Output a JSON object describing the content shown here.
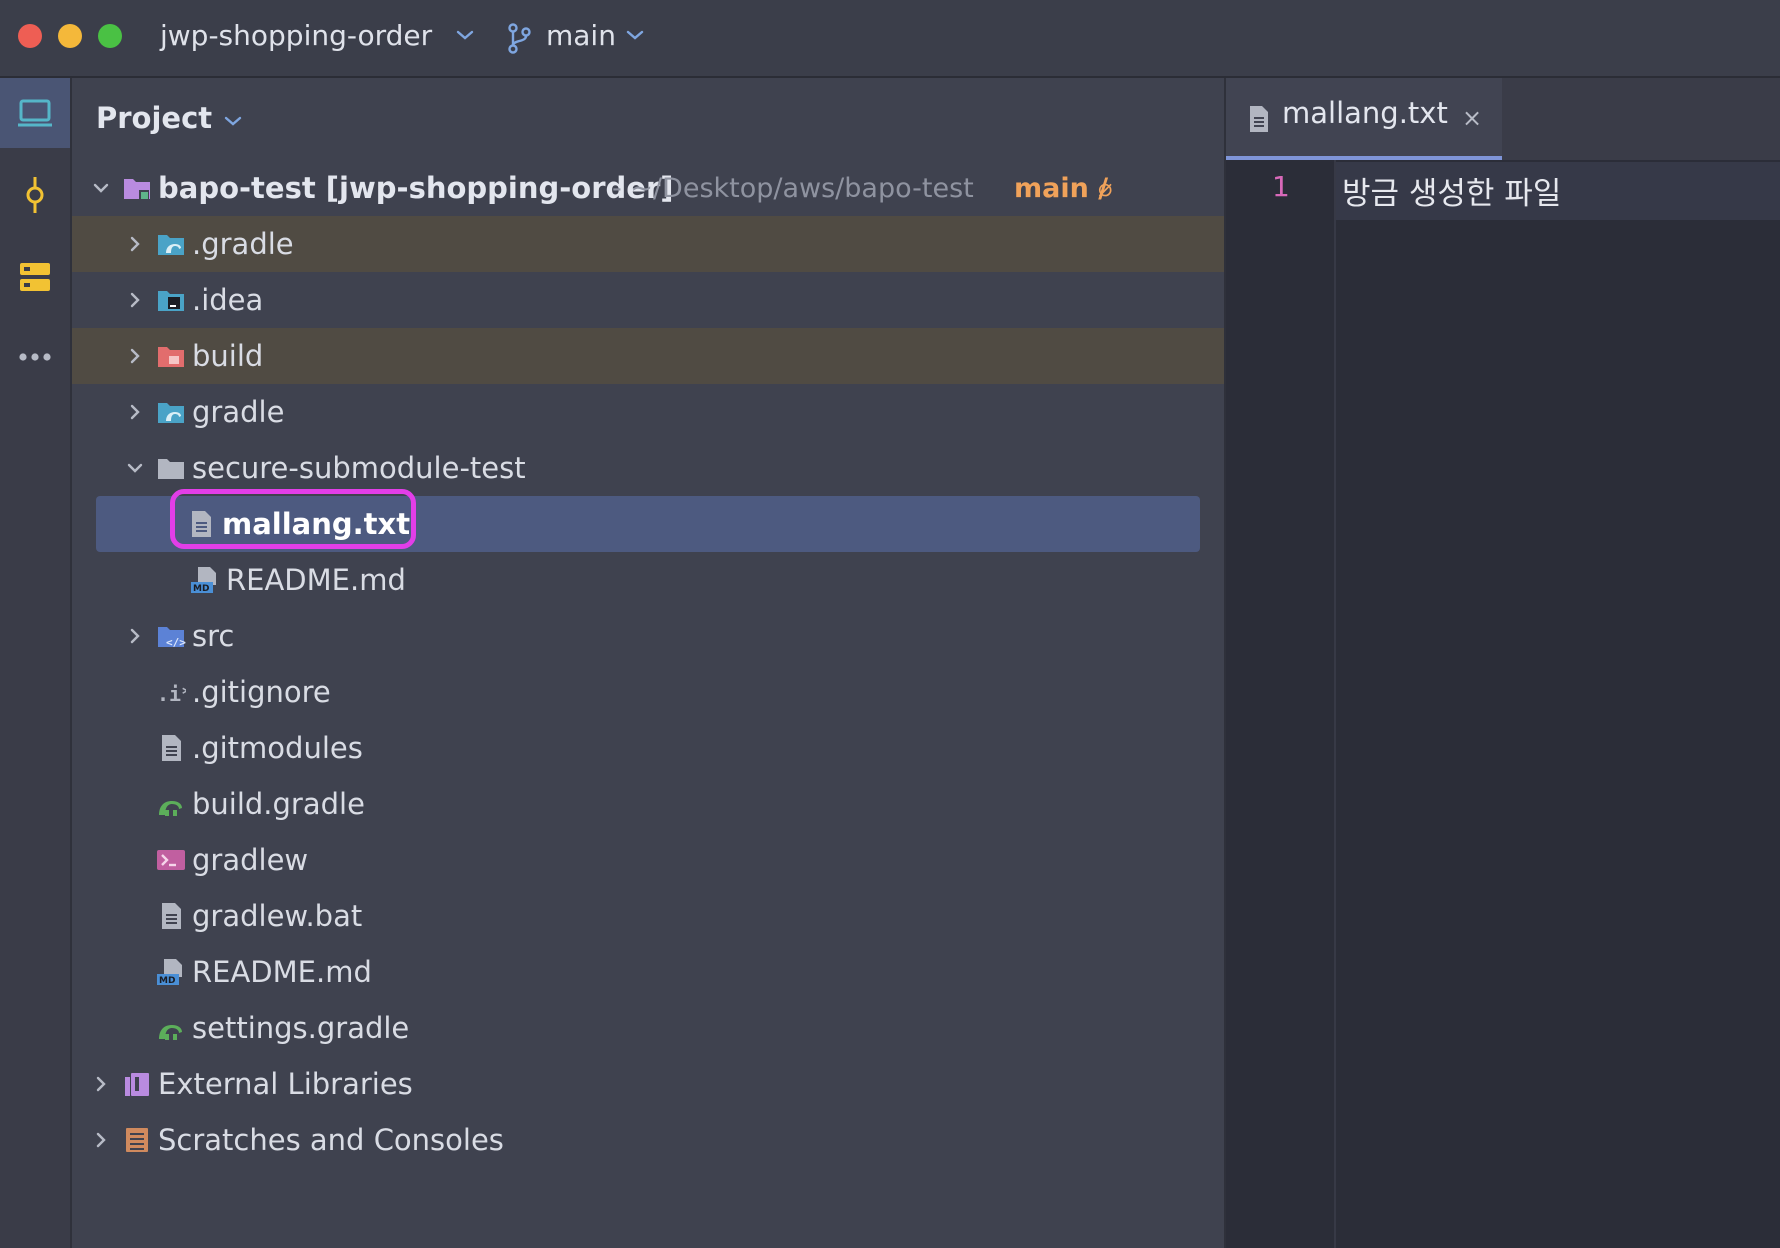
{
  "titlebar": {
    "project_name": "jwp-shopping-order",
    "branch": "main"
  },
  "toolstrip": {
    "items": [
      "project-view-icon",
      "commit-icon",
      "structure-icon",
      "more-icon"
    ]
  },
  "project_panel": {
    "title": "Project",
    "root": {
      "name": "bapo-test [jwp-shopping-order]",
      "path": " - ~/Desktop/aws/bapo-test",
      "branch": "main /",
      "status": "⌀"
    },
    "items": [
      {
        "label": ".gradle",
        "icon": "gradle-folder-icon"
      },
      {
        "label": ".idea",
        "icon": "idea-folder-icon"
      },
      {
        "label": "build",
        "icon": "build-folder-icon"
      },
      {
        "label": "gradle",
        "icon": "gradle-folder-icon"
      },
      {
        "label": "secure-submodule-test",
        "icon": "folder-icon"
      },
      {
        "label": "mallang.txt",
        "icon": "text-file-icon"
      },
      {
        "label": "README.md",
        "icon": "markdown-file-icon"
      },
      {
        "label": "src",
        "icon": "source-folder-icon"
      },
      {
        "label": ".gitignore",
        "icon": "gitignore-file-icon"
      },
      {
        "label": ".gitmodules",
        "icon": "text-file-icon"
      },
      {
        "label": "build.gradle",
        "icon": "gradle-file-icon"
      },
      {
        "label": "gradlew",
        "icon": "shell-script-icon"
      },
      {
        "label": "gradlew.bat",
        "icon": "text-file-icon"
      },
      {
        "label": "README.md",
        "icon": "markdown-file-icon"
      },
      {
        "label": "settings.gradle",
        "icon": "gradle-file-icon"
      },
      {
        "label": "External Libraries",
        "icon": "libraries-icon"
      },
      {
        "label": "Scratches and Consoles",
        "icon": "scratches-icon"
      }
    ]
  },
  "editor": {
    "tab_label": "mallang.txt",
    "tab_close": "×",
    "lines": [
      {
        "number": "1",
        "text": "방금 생성한 파일"
      }
    ]
  },
  "colors": {
    "accent": "#7f95d8",
    "selection": "#4d5a80",
    "highlight_ring": "#e23ee8",
    "ignored_row": "#504b43",
    "branch": "#f0a25a"
  }
}
